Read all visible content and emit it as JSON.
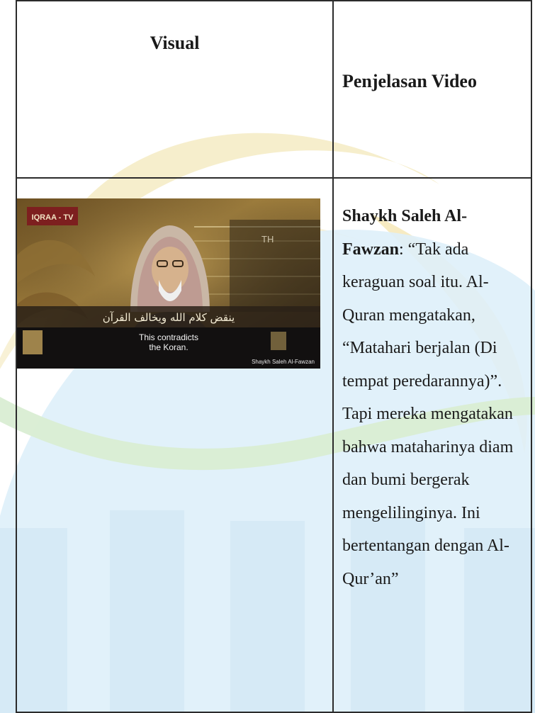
{
  "table": {
    "header_visual": "Visual",
    "header_text": "Penjelasan Video"
  },
  "video": {
    "channel_logo": "IQRAA - TV",
    "corner_mark": "TH",
    "arabic_subtitle": "ينقض كلام الله ويخالف القرآن",
    "english_subtitle_line1": "This contradicts",
    "english_subtitle_line2": "the Koran.",
    "speaker_caption": "Shaykh Saleh Al-Fawzan"
  },
  "description": {
    "speaker_name": "Shaykh Saleh Al-Fawzan",
    "quote": ": “Tak ada keraguan soal itu. Al-Quran mengatakan, “Matahari berjalan (Di tempat peredarannya)”. Tapi mereka mengatakan bahwa mataharinya diam dan bumi bergerak mengelilinginya. Ini bertentangan dengan Al-Qur’an”"
  },
  "colors": {
    "watermark_gold": "#f3e6b3",
    "watermark_green": "#d8ecd5",
    "watermark_blue": "#d6eaf6",
    "border": "#2b2b2b"
  }
}
